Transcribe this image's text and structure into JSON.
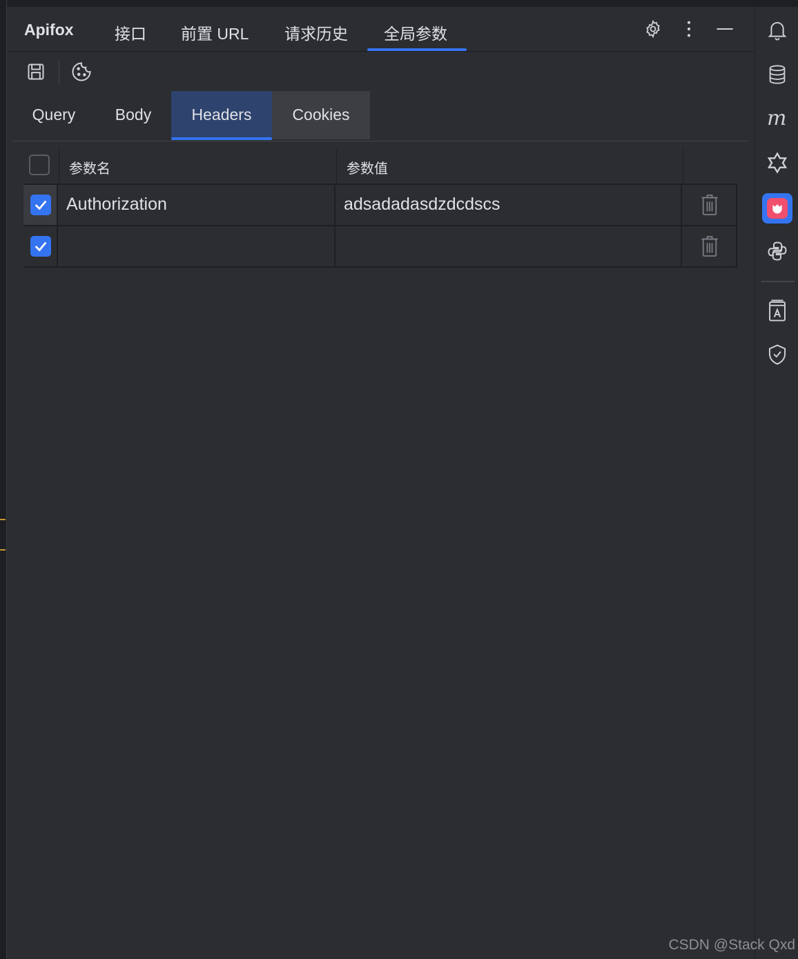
{
  "app": {
    "title": "Apifox"
  },
  "top_tabs": [
    {
      "label": "接口"
    },
    {
      "label": "前置 URL"
    },
    {
      "label": "请求历史"
    },
    {
      "label": "全局参数",
      "active": true
    }
  ],
  "title_icons": [
    "gear-icon",
    "more-vertical-icon",
    "minimize-icon"
  ],
  "toolbar_icons": [
    "save-icon",
    "cookie-icon"
  ],
  "sub_tabs": [
    {
      "label": "Query"
    },
    {
      "label": "Body"
    },
    {
      "label": "Headers",
      "active": true
    },
    {
      "label": "Cookies"
    }
  ],
  "table": {
    "headers": {
      "name": "参数名",
      "value": "参数值"
    },
    "rows": [
      {
        "checked": true,
        "name": "Authorization",
        "value": "adsadadasdzdcdscs"
      },
      {
        "checked": true,
        "name": "",
        "value": ""
      }
    ]
  },
  "right_bar_icons": [
    "bell-icon",
    "database-icon",
    "m-icon",
    "ai-assistant-icon",
    "apifox-plugin-icon",
    "python-icon",
    "translate-icon",
    "shield-check-icon"
  ],
  "colors": {
    "accent": "#3574f0",
    "background": "#2b2d30",
    "text": "#dfe1e5"
  },
  "watermark": "CSDN @Stack Qxd"
}
